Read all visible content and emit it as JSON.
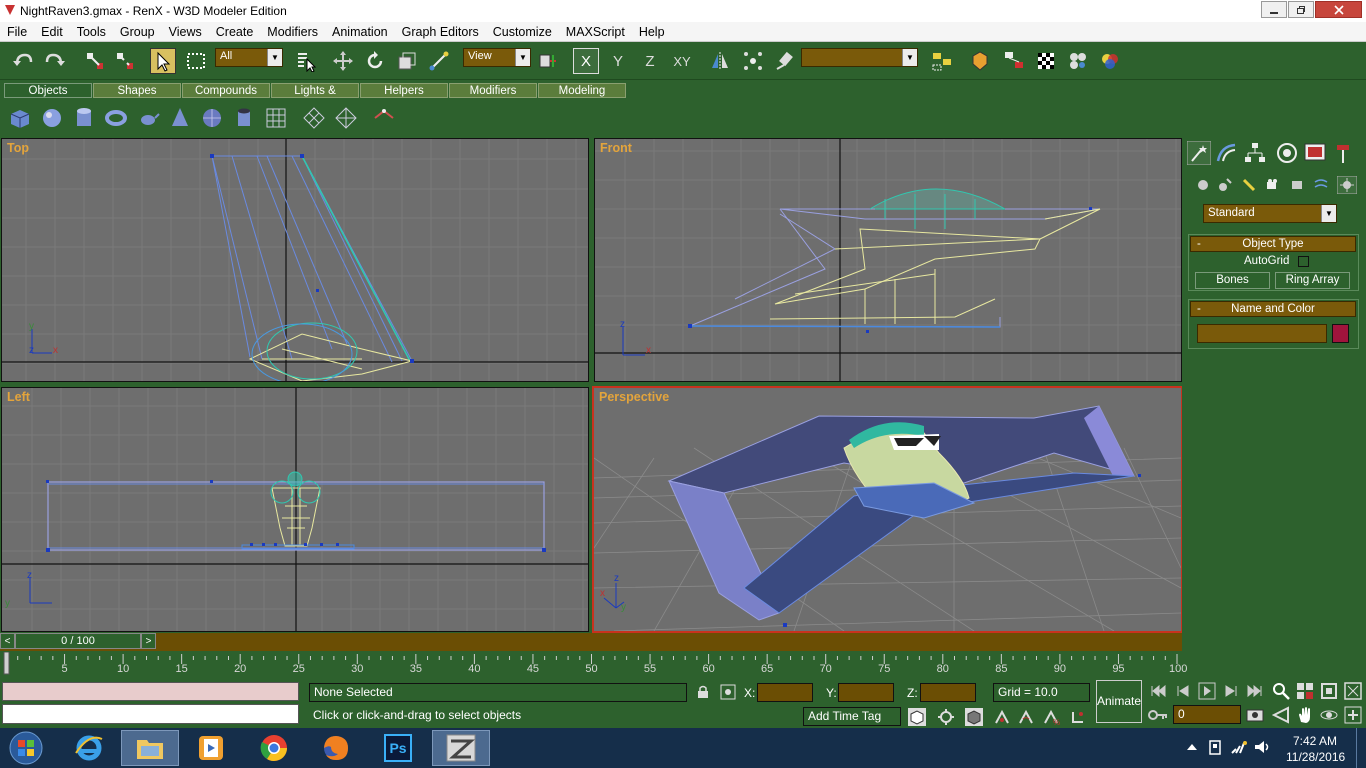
{
  "window": {
    "title": "NightRaven3.gmax - RenX - W3D Modeler Edition",
    "minimize_icon": "minimize-icon",
    "maximize_icon": "restore-icon",
    "close_icon": "close-icon"
  },
  "menu": {
    "items": [
      "File",
      "Edit",
      "Tools",
      "Group",
      "Views",
      "Create",
      "Modifiers",
      "Animation",
      "Graph Editors",
      "Customize",
      "MAXScript",
      "Help"
    ]
  },
  "toolbar": {
    "selection_filter": "All",
    "reference_coord": "View",
    "axis_x": "X",
    "axis_y": "Y",
    "axis_z": "Z",
    "axis_xy": "XY",
    "named_selection": ""
  },
  "tabs": {
    "items": [
      "Objects",
      "Shapes",
      "Compounds",
      "Lights & Cameras",
      "Helpers",
      "Modifiers",
      "Modeling"
    ],
    "active": "Objects"
  },
  "viewports": {
    "top": "Top",
    "front": "Front",
    "left": "Left",
    "perspective": "Perspective",
    "axis_x": "x",
    "axis_y": "y",
    "axis_z": "z"
  },
  "command_panel": {
    "category": "Standard",
    "object_type_title": "Object Type",
    "autogrid_label": "AutoGrid",
    "bones_button": "Bones",
    "ring_array_button": "Ring Array",
    "name_color_title": "Name and Color",
    "name_value": "",
    "color_swatch": "#a0143c",
    "collapse_symbol": "-"
  },
  "timeline": {
    "frame_display": "0 / 100",
    "prev_symbol": "<",
    "next_symbol": ">",
    "ticks": [
      "5",
      "10",
      "15",
      "20",
      "25",
      "30",
      "35",
      "40",
      "45",
      "50",
      "55",
      "60",
      "65",
      "70",
      "75",
      "80",
      "85",
      "90",
      "95",
      "100"
    ]
  },
  "status": {
    "selection": "None Selected",
    "prompt": "Click or click-and-drag to select objects",
    "x_label": "X:",
    "y_label": "Y:",
    "z_label": "Z:",
    "x_value": "",
    "y_value": "",
    "z_value": "",
    "grid": "Grid = 10.0",
    "add_time_tag": "Add Time Tag",
    "animate": "Animate",
    "current_frame": "0"
  },
  "taskbar": {
    "time": "7:42 AM",
    "date": "11/28/2016",
    "ps_label": "Ps"
  }
}
